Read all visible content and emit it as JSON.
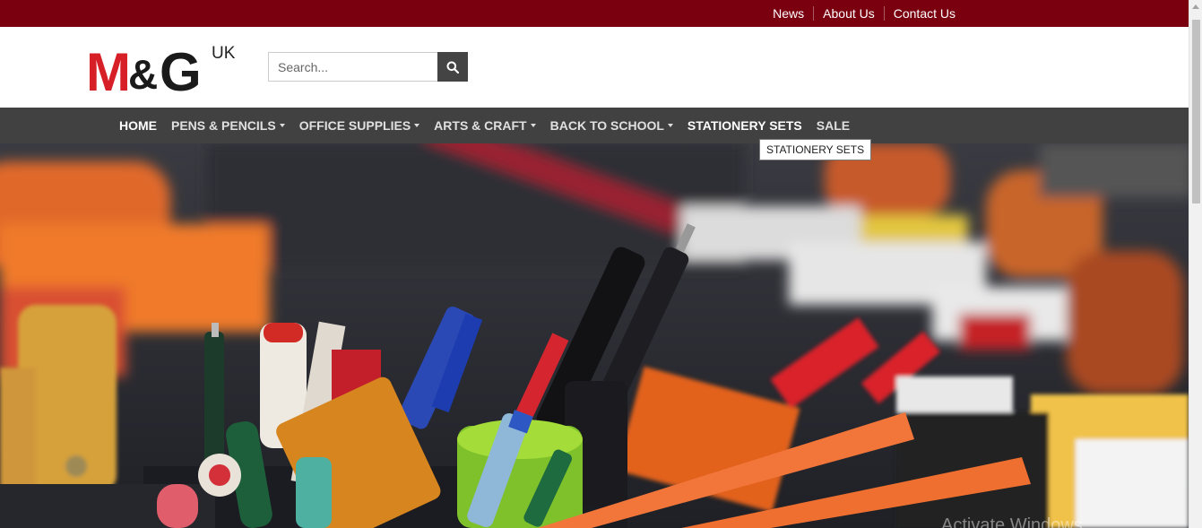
{
  "topbar": {
    "links": [
      "News",
      "About Us",
      "Contact Us"
    ]
  },
  "logo": {
    "brand": "M&G",
    "region": "UK"
  },
  "search": {
    "placeholder": "Search..."
  },
  "nav": {
    "items": [
      {
        "label": "HOME",
        "dropdown": false
      },
      {
        "label": "PENS & PENCILS",
        "dropdown": true
      },
      {
        "label": "OFFICE SUPPLIES",
        "dropdown": true
      },
      {
        "label": "ARTS & CRAFT",
        "dropdown": true
      },
      {
        "label": "BACK TO SCHOOL",
        "dropdown": true
      },
      {
        "label": "STATIONERY SETS",
        "dropdown": false
      },
      {
        "label": "SALE",
        "dropdown": false
      }
    ],
    "tooltip": "STATIONERY SETS"
  },
  "overlay": {
    "watermark": "Activate Windows"
  },
  "colors": {
    "topbar": "#7a0010",
    "nav": "#414141",
    "brand_red": "#d61f26",
    "search_button": "#444444"
  }
}
